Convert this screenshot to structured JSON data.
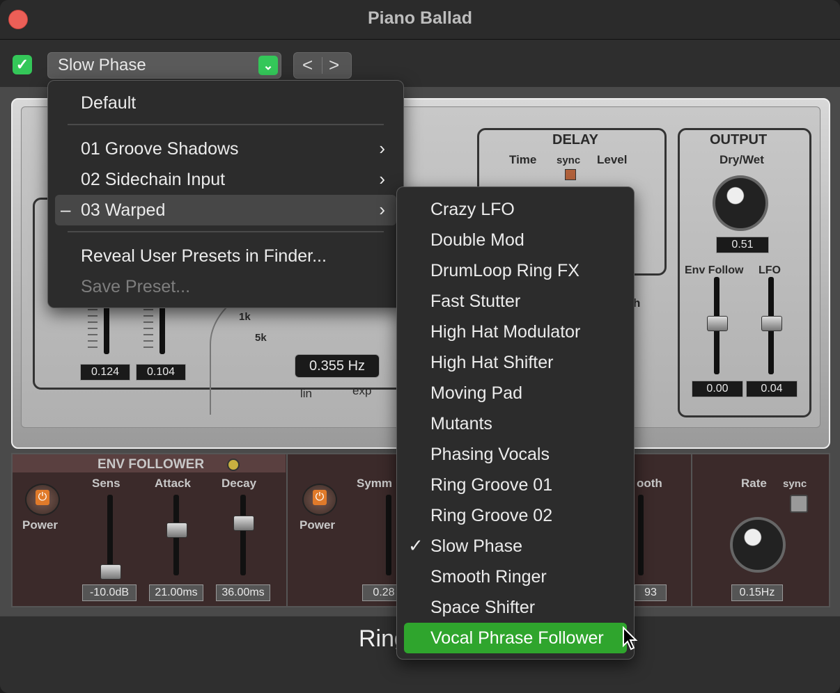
{
  "window": {
    "title": "Piano Ballad"
  },
  "toolbar": {
    "enable_checked": true,
    "preset_name": "Slow Phase",
    "prev_label": "<",
    "next_label": ">"
  },
  "plugin": {
    "delay": {
      "title": "DELAY",
      "time_label": "Time",
      "sync_label": "sync",
      "level_label": "Level"
    },
    "output": {
      "title": "OUTPUT",
      "drywet_label": "Dry/Wet",
      "drywet_value": "0.51",
      "envfollow_label": "Env Follow",
      "lfo_label": "LFO",
      "envfollow_value": "0.00",
      "lfo_value": "0.04"
    },
    "width_label_partial": "dth",
    "left_faders": {
      "value1": "0.124",
      "value2": "0.104"
    },
    "freq": {
      "label_1k": "1k",
      "label_5k": "5k",
      "value": "0.355 Hz",
      "lin": "lin",
      "exp": "exp"
    },
    "env_follower": {
      "title": "ENV FOLLOWER",
      "power_label": "Power",
      "sens_label": "Sens",
      "attack_label": "Attack",
      "decay_label": "Decay",
      "sens_value": "-10.0dB",
      "attack_value": "21.00ms",
      "decay_value": "36.00ms"
    },
    "lfo_section": {
      "power_label": "Power",
      "symm_label": "Symm",
      "symm_value": "0.28",
      "smooth_label": "ooth",
      "smooth_value": "93",
      "rate_label": "Rate",
      "sync_label": "sync",
      "rate_value": "0.15Hz"
    },
    "bottom_name": "Ring"
  },
  "menu_main": {
    "items": [
      {
        "label": "Default"
      },
      {
        "label": "01 Groove Shadows",
        "submenu": true
      },
      {
        "label": "02 Sidechain Input",
        "submenu": true
      },
      {
        "label": "03 Warped",
        "submenu": true,
        "mark": "–"
      },
      {
        "label": "Reveal User Presets in Finder..."
      },
      {
        "label": "Save Preset...",
        "disabled": true
      }
    ]
  },
  "menu_sub": {
    "items": [
      {
        "label": "Crazy LFO"
      },
      {
        "label": "Double Mod"
      },
      {
        "label": "DrumLoop Ring FX"
      },
      {
        "label": "Fast Stutter"
      },
      {
        "label": "High Hat Modulator"
      },
      {
        "label": "High Hat Shifter"
      },
      {
        "label": "Moving Pad"
      },
      {
        "label": "Mutants"
      },
      {
        "label": "Phasing Vocals"
      },
      {
        "label": "Ring Groove 01"
      },
      {
        "label": "Ring Groove 02"
      },
      {
        "label": "Slow Phase",
        "mark": "✓"
      },
      {
        "label": "Smooth Ringer"
      },
      {
        "label": "Space Shifter"
      },
      {
        "label": "Vocal Phrase Follower"
      }
    ]
  },
  "colors": {
    "accent_green": "#34c759",
    "selection_green": "#2fa52d",
    "close_red": "#ec5f57"
  }
}
